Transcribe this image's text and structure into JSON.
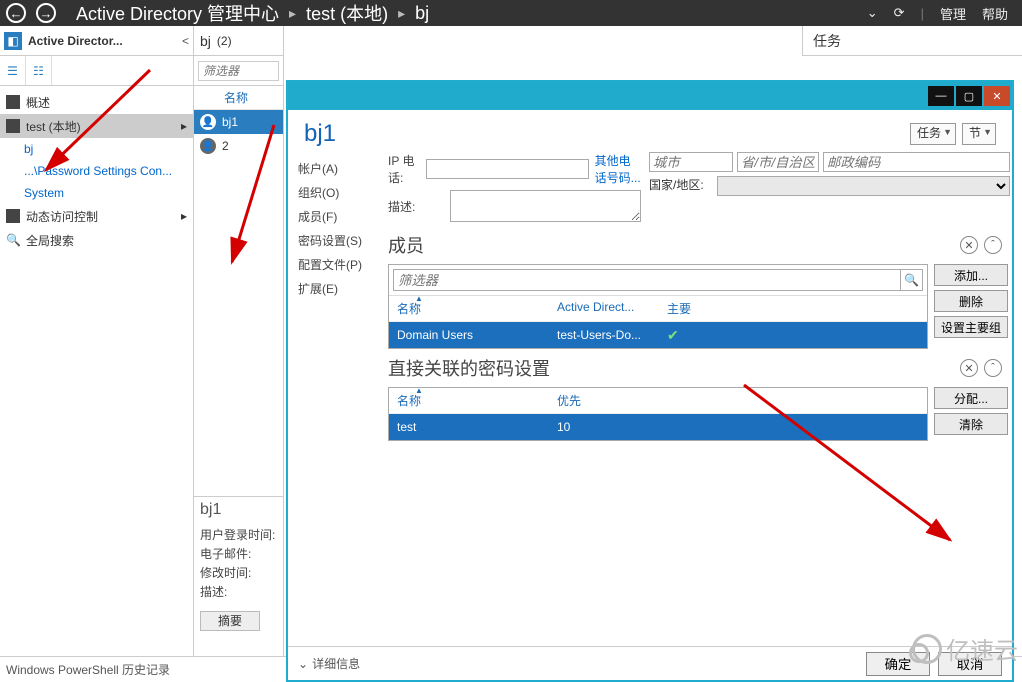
{
  "titlebar": {
    "app": "Active Directory 管理中心",
    "crumb1": "test (本地)",
    "crumb2": "bj",
    "manage": "管理",
    "help": "帮助"
  },
  "sidebar": {
    "headerTitle": "Active Director...",
    "overview": "概述",
    "selectedNode": "test (本地)",
    "bj": "bj",
    "pwdSettings": "...\\Password Settings Con...",
    "system": "System",
    "dynAccess": "动态访问控制",
    "globalSearch": "全局搜索"
  },
  "mid": {
    "header": "bj",
    "count": "(2)",
    "filterPlaceholder": "筛选器",
    "colName": "名称",
    "row1": "bj1",
    "row2": "2",
    "detailTitle": "bj1",
    "d1": "用户登录时间:",
    "d2": "电子邮件:",
    "d3": "修改时间:",
    "d4": "描述:",
    "summary": "摘要"
  },
  "tasksLabel": "任务",
  "dialog": {
    "title": "bj1",
    "ddTasks": "任务",
    "ddSect": "节",
    "nav": {
      "account": "帐户(A)",
      "org": "组织(O)",
      "member": "成员(F)",
      "pwd": "密码设置(S)",
      "profile": "配置文件(P)",
      "ext": "扩展(E)"
    },
    "ipPhoneLbl": "IP 电话:",
    "descLbl": "描述:",
    "otherPhone": "其他电话号码...",
    "cityPh": "城市",
    "provPh": "省/市/自治区",
    "postalPh": "邮政编码",
    "countryLbl": "国家/地区:",
    "sectMembers": "成员",
    "sectPwd": "直接关联的密码设置",
    "filterPh": "筛选器",
    "colName": "名称",
    "colAD": "Active Direct...",
    "colMain": "主要",
    "colPrio": "优先",
    "memRowName": "Domain Users",
    "memRowAD": "test-Users-Do...",
    "pwdRowName": "test",
    "pwdRowPrio": "10",
    "btnAdd": "添加...",
    "btnDel": "删除",
    "btnSetMain": "设置主要组",
    "btnAssign": "分配...",
    "btnClear": "清除",
    "more": "详细信息",
    "ok": "确定",
    "cancel": "取消"
  },
  "statusbar": "Windows PowerShell 历史记录",
  "watermark": "亿速云"
}
